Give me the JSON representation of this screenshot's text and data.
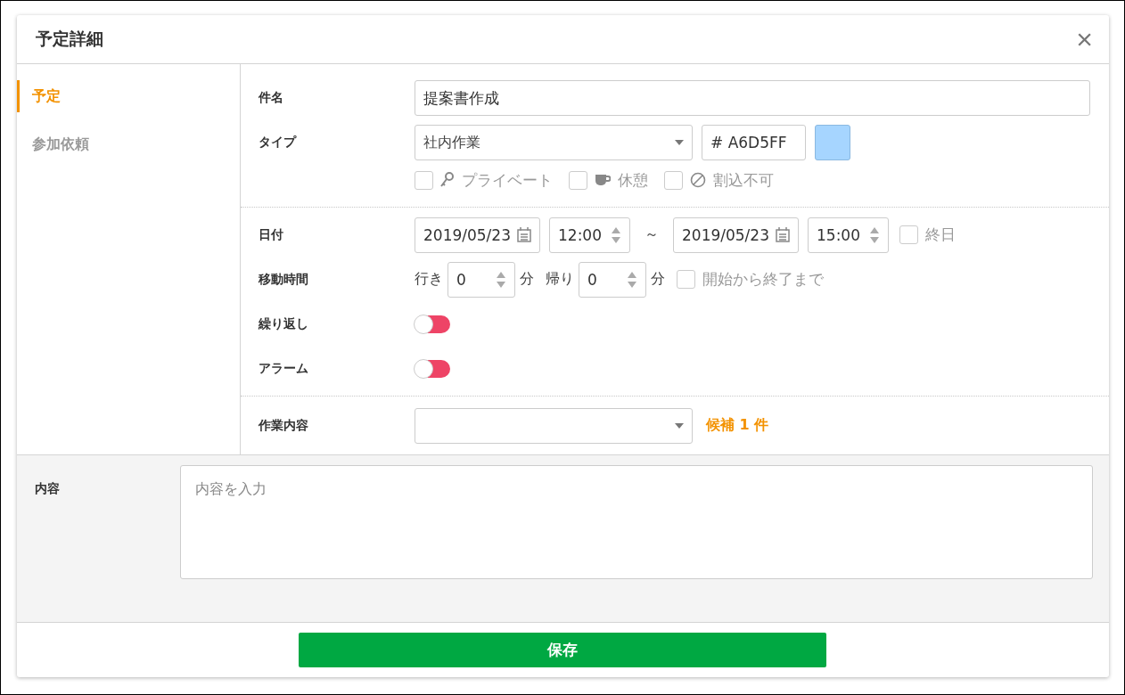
{
  "dialog": {
    "title": "予定詳細",
    "close": "×"
  },
  "sidebar": {
    "items": [
      {
        "label": "予定",
        "selected": true
      },
      {
        "label": "参加依頼",
        "selected": false
      }
    ]
  },
  "subject": {
    "label": "件名",
    "value": "提案書作成"
  },
  "type": {
    "label": "タイプ",
    "value": "社内作業",
    "hex": "# A6D5FF",
    "color": "#a6d5ff",
    "flags": [
      {
        "kind": "key",
        "label": "プライベート",
        "checked": false
      },
      {
        "kind": "cup",
        "label": "休憩",
        "checked": false
      },
      {
        "kind": "ban",
        "label": "割込不可",
        "checked": false
      }
    ]
  },
  "date": {
    "label": "日付",
    "start_date": "2019/05/23",
    "start_time": "12:00",
    "separator": "～",
    "end_date": "2019/05/23",
    "end_time": "15:00",
    "all_day": {
      "label": "終日",
      "checked": false
    }
  },
  "travel": {
    "label": "移動時間",
    "go_label": "行き",
    "go_value": "0",
    "go_unit": "分",
    "back_label": "帰り",
    "back_value": "0",
    "back_unit": "分",
    "span": {
      "label": "開始から終了まで",
      "checked": false
    }
  },
  "toggles": [
    {
      "label": "繰り返し",
      "on": false
    },
    {
      "label": "アラーム",
      "on": false
    }
  ],
  "work": {
    "label": "作業内容",
    "candidates": "候補 1 件"
  },
  "content": {
    "label": "内容",
    "placeholder": "内容を入力"
  },
  "save": "保存"
}
